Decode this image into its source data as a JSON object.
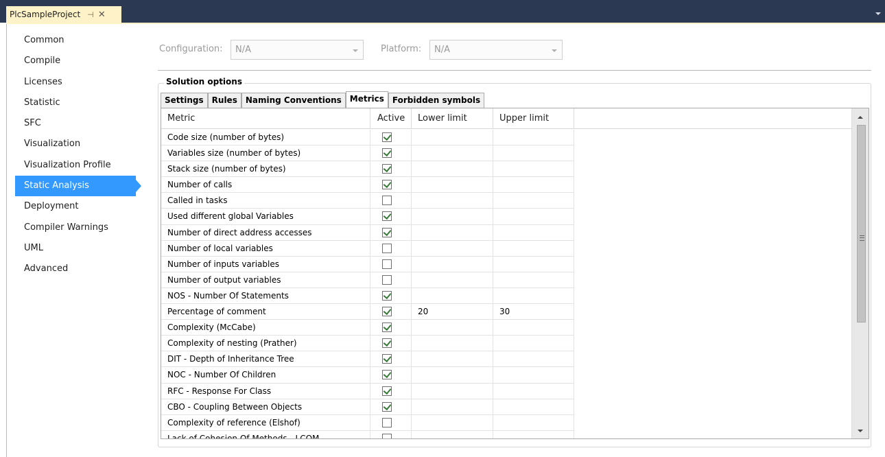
{
  "document_tab": {
    "title": "PlcSampleProject",
    "pin_glyph": "⊣",
    "close_glyph": "✕"
  },
  "nav": {
    "selected": "Static Analysis",
    "items": [
      {
        "label": "Common"
      },
      {
        "label": "Compile"
      },
      {
        "label": "Licenses"
      },
      {
        "label": "Statistic"
      },
      {
        "label": "SFC"
      },
      {
        "label": "Visualization"
      },
      {
        "label": "Visualization Profile"
      },
      {
        "label": "Static Analysis"
      },
      {
        "label": "Deployment"
      },
      {
        "label": "Compiler Warnings"
      },
      {
        "label": "UML"
      },
      {
        "label": "Advanced"
      }
    ]
  },
  "config": {
    "configuration_label": "Configuration:",
    "configuration_value": "N/A",
    "platform_label": "Platform:",
    "platform_value": "N/A"
  },
  "solution_options": {
    "caption": "Solution options",
    "tabs": [
      {
        "label": "Settings",
        "active": false
      },
      {
        "label": "Rules",
        "active": false
      },
      {
        "label": "Naming Conventions",
        "active": false
      },
      {
        "label": "Metrics",
        "active": true
      },
      {
        "label": "Forbidden symbols",
        "active": false
      }
    ],
    "grid": {
      "headers": {
        "metric": "Metric",
        "active": "Active",
        "lower": "Lower limit",
        "upper": "Upper limit"
      },
      "rows": [
        {
          "metric": "Code size (number of bytes)",
          "active": true,
          "lower": "",
          "upper": ""
        },
        {
          "metric": "Variables size (number of bytes)",
          "active": true,
          "lower": "",
          "upper": ""
        },
        {
          "metric": "Stack size (number of bytes)",
          "active": true,
          "lower": "",
          "upper": ""
        },
        {
          "metric": "Number of calls",
          "active": true,
          "lower": "",
          "upper": ""
        },
        {
          "metric": "Called in tasks",
          "active": false,
          "lower": "",
          "upper": ""
        },
        {
          "metric": "Used different global Variables",
          "active": true,
          "lower": "",
          "upper": ""
        },
        {
          "metric": "Number of direct address accesses",
          "active": true,
          "lower": "",
          "upper": ""
        },
        {
          "metric": "Number of local variables",
          "active": false,
          "lower": "",
          "upper": ""
        },
        {
          "metric": "Number of inputs variables",
          "active": false,
          "lower": "",
          "upper": ""
        },
        {
          "metric": "Number of output variables",
          "active": false,
          "lower": "",
          "upper": ""
        },
        {
          "metric": "NOS - Number Of Statements",
          "active": true,
          "lower": "",
          "upper": ""
        },
        {
          "metric": "Percentage of comment",
          "active": true,
          "lower": "20",
          "upper": "30"
        },
        {
          "metric": "Complexity (McCabe)",
          "active": true,
          "lower": "",
          "upper": ""
        },
        {
          "metric": "Complexity of nesting (Prather)",
          "active": true,
          "lower": "",
          "upper": ""
        },
        {
          "metric": "DIT - Depth of Inheritance Tree",
          "active": true,
          "lower": "",
          "upper": ""
        },
        {
          "metric": "NOC - Number Of Children",
          "active": true,
          "lower": "",
          "upper": ""
        },
        {
          "metric": "RFC - Response For Class",
          "active": true,
          "lower": "",
          "upper": ""
        },
        {
          "metric": "CBO - Coupling Between Objects",
          "active": true,
          "lower": "",
          "upper": ""
        },
        {
          "metric": "Complexity of reference (Elshof)",
          "active": false,
          "lower": "",
          "upper": ""
        },
        {
          "metric": "Lack of Cohesion Of Methods - LCOM",
          "active": false,
          "lower": "",
          "upper": ""
        }
      ]
    }
  },
  "colors": {
    "titlebar": "#2b3a52",
    "doc_tab": "#fef3c8",
    "nav_selected": "#3399ff"
  },
  "icons": {
    "pin": "pin-icon",
    "close": "close-icon",
    "tab_menu": "chevron-down-icon",
    "combo_arrow": "chevron-down-icon",
    "check": "check-icon",
    "scroll_up": "arrow-up-icon",
    "scroll_down": "arrow-down-icon",
    "scroll_grip": "grip-icon"
  }
}
